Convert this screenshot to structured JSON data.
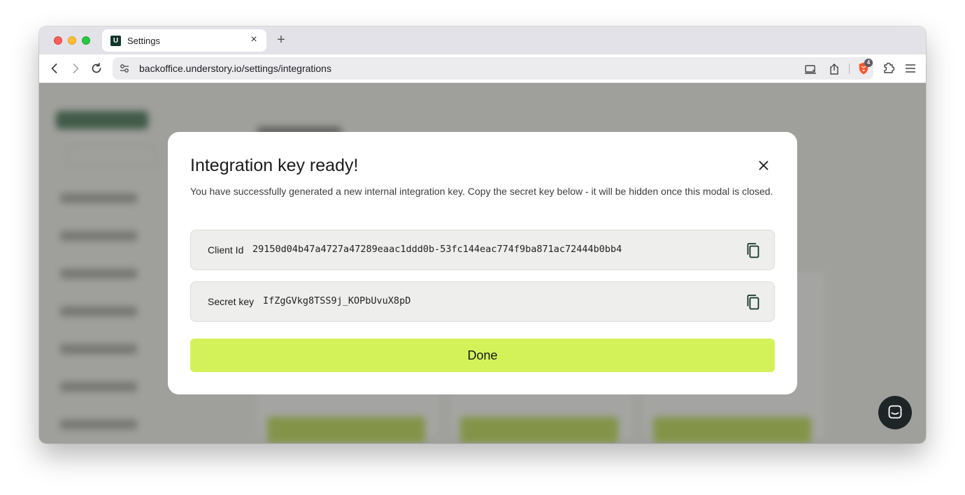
{
  "browser": {
    "tab": {
      "title": "Settings",
      "favicon_letter": "U"
    },
    "address": {
      "url": "backoffice.understory.io/settings/integrations"
    },
    "brave_badge": "4"
  },
  "modal": {
    "title": "Integration key ready!",
    "description": "You have successfully generated a new internal integration key. Copy the secret key below - it will be hidden once this modal is closed.",
    "client_id": {
      "label": "Client Id",
      "value": "29150d04b47a4727a47289eaac1ddd0b-53fc144eac774f9ba871ac72444b0bb4"
    },
    "secret_key": {
      "label": "Secret key",
      "value": "IfZgGVkg8TSS9j_KOPbUvuX8pD"
    },
    "done_label": "Done"
  },
  "colors": {
    "accent": "#d3f25a",
    "brand": "#12352a"
  },
  "icons": [
    "close-icon",
    "copy-icon",
    "chat-icon",
    "back-icon",
    "forward-icon",
    "reload-icon",
    "site-settings-icon",
    "cast-icon",
    "share-icon",
    "brave-shield-icon",
    "extensions-icon",
    "menu-icon"
  ]
}
